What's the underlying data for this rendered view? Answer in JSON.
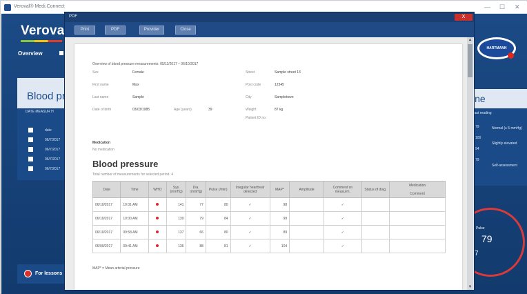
{
  "window": {
    "title": "Veroval® Medi.Connect",
    "min_icon": "minimize-icon",
    "max_icon": "maximize-icon",
    "close_icon": "close-icon"
  },
  "app": {
    "logo_text": "Veroval®",
    "nav": [
      "Overview"
    ],
    "left_panel_title": "Blood pr",
    "left_columns": "DATE   MEASUR   H",
    "left_rows": [
      "date",
      "06/7/2017",
      "06/7/2017",
      "06/7/2017",
      "06/7/2017"
    ],
    "bottom_button": "For lessons",
    "brand_badge": "HARTMANN",
    "right_panel_title": "ine",
    "right_items": [
      "Last reading",
      "79",
      "100",
      "94",
      "79"
    ],
    "right_notes": [
      "Normal (≥ 5 mmHg)",
      "Slightly elevated",
      "Self-assessment"
    ],
    "gauge_label": "Pulse",
    "gauge_value": "79",
    "gauge_value2": "7"
  },
  "dialog": {
    "title": "PDF",
    "close_label": "X",
    "toolbar": [
      "Print",
      "PDF",
      "Provider",
      "Close"
    ]
  },
  "report": {
    "title": "Overview of blood pressure measurements: 05/11/2017 – 06/10/2017",
    "fields": [
      {
        "label": "Sex",
        "value": "Female"
      },
      {
        "label": "First name",
        "value": "Max"
      },
      {
        "label": "Last name",
        "value": "Sample"
      },
      {
        "label": "Date of birth",
        "value": "03/03/1985"
      },
      {
        "label": "Age (years)",
        "value": "39"
      },
      {
        "label": "Street",
        "value": "Sample street 13"
      },
      {
        "label": "Post code",
        "value": "12345"
      },
      {
        "label": "City",
        "value": "Sampletown"
      },
      {
        "label": "Weight",
        "value": "87 kg"
      },
      {
        "label": "Patient ID no.",
        "value": ""
      }
    ],
    "medication_heading": "Medication",
    "medication_text": "No medication",
    "section_title": "Blood pressure",
    "section_subtitle": "Total number of measurements for selected period: 4",
    "columns": [
      "Date",
      "Time",
      "WHO",
      "Sys. (mmHg)",
      "Dia. (mmHg)",
      "Pulse (/min)",
      "Irregular heartbeat detected",
      "MAP*",
      "Amplitude",
      "Comment on measurm.",
      "Status of diag.",
      "Medication"
    ],
    "column_sub_last": "Comment",
    "rows": [
      [
        "06/10/2017",
        "10:01 AM",
        "",
        "141",
        "77",
        "80",
        "✓",
        "98",
        "",
        "✓",
        "",
        ""
      ],
      [
        "06/10/2017",
        "10:00 AM",
        "",
        "139",
        "79",
        "84",
        "✓",
        "99",
        "",
        "✓",
        "",
        ""
      ],
      [
        "06/10/2017",
        "09:58 AM",
        "",
        "137",
        "66",
        "80",
        "✓",
        "89",
        "",
        "✓",
        "",
        ""
      ],
      [
        "06/09/2017",
        "09:41 AM",
        "",
        "136",
        "88",
        "81",
        "✓",
        "104",
        "",
        "✓",
        "",
        ""
      ]
    ],
    "footnote": "MAP* = Mean arterial pressure"
  }
}
